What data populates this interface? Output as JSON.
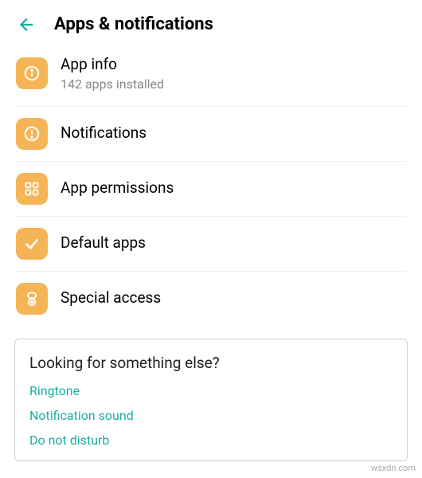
{
  "header": {
    "title": "Apps & notifications"
  },
  "items": [
    {
      "title": "App info",
      "subtitle": "142 apps installed"
    },
    {
      "title": "Notifications"
    },
    {
      "title": "App permissions"
    },
    {
      "title": "Default apps"
    },
    {
      "title": "Special access"
    }
  ],
  "suggestions": {
    "heading": "Looking for something else?",
    "links": [
      "Ringtone",
      "Notification sound",
      "Do not disturb"
    ]
  },
  "watermark": "wsxdn.com",
  "colors": {
    "accent": "#1aaf9e",
    "icon_bg": "#f5b556"
  }
}
